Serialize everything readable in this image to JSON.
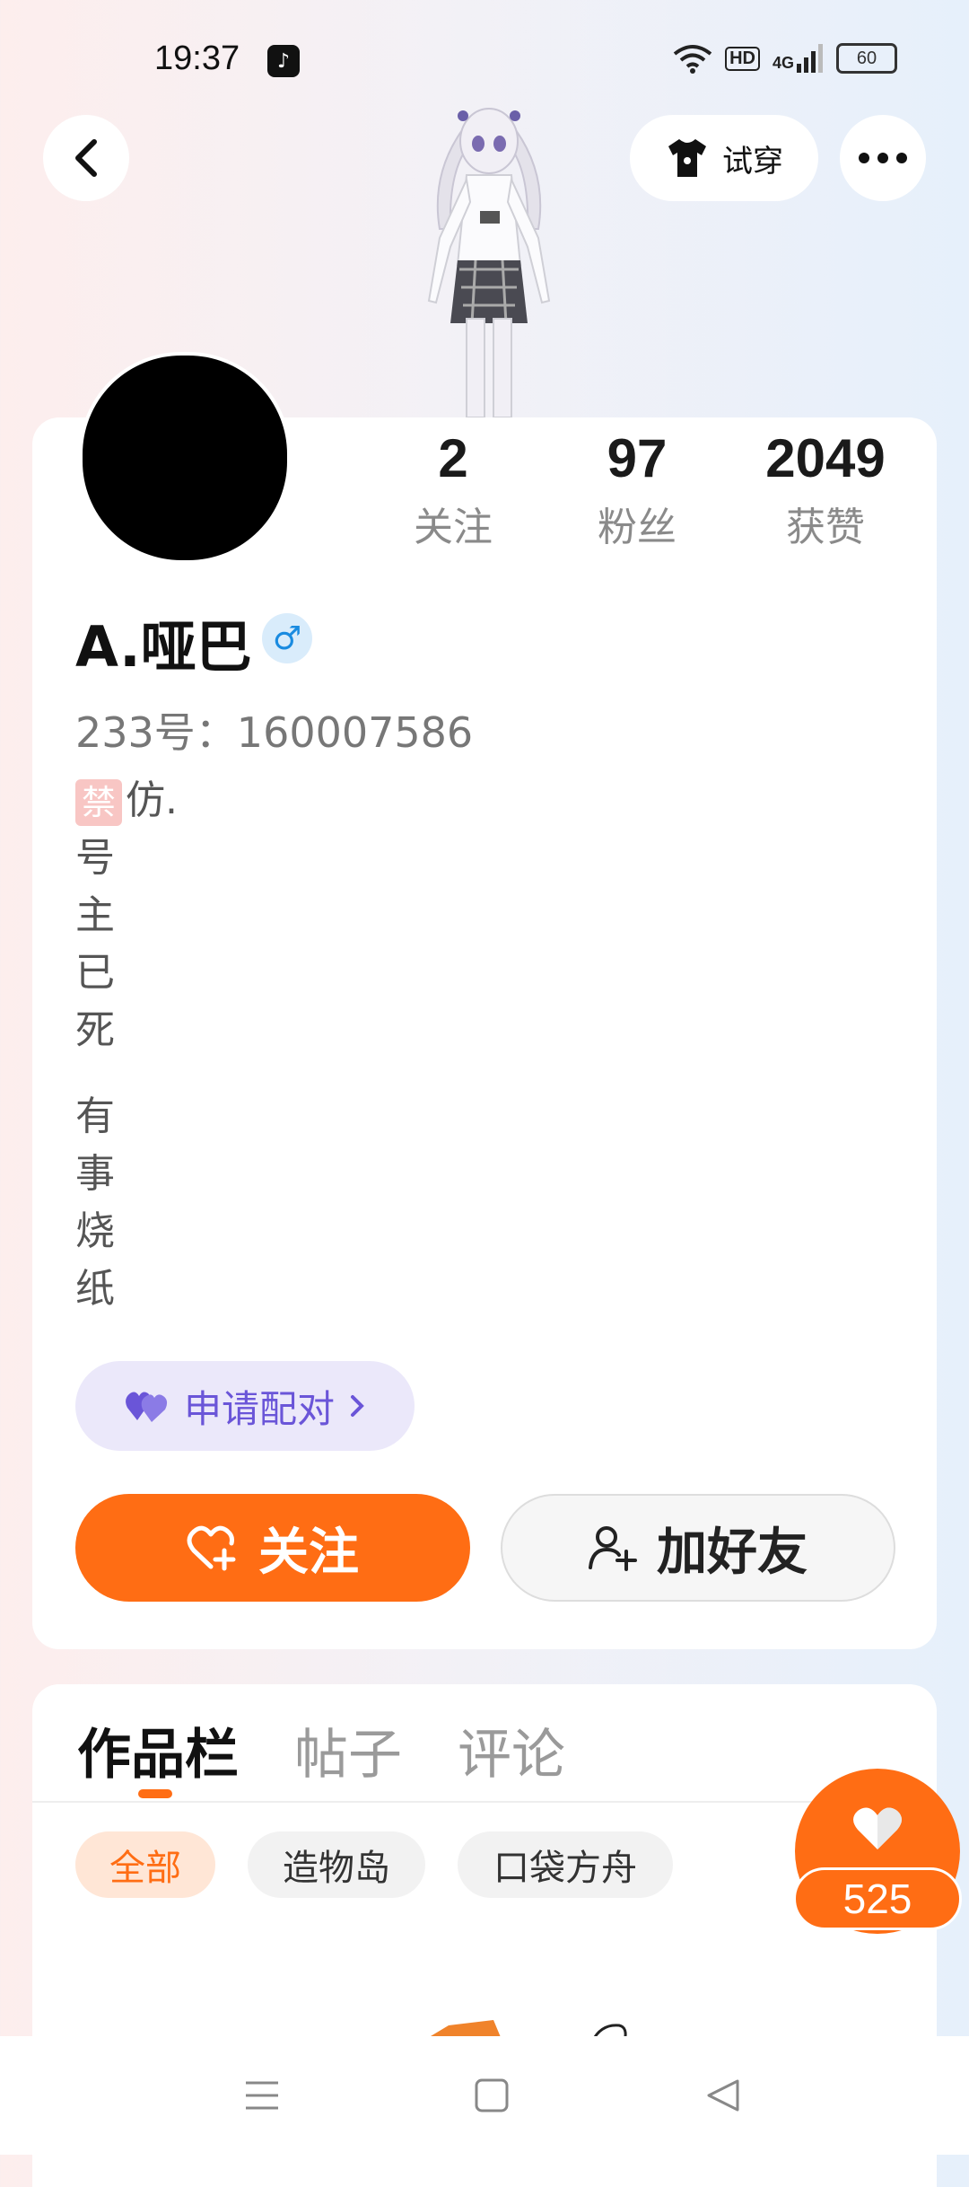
{
  "status_bar": {
    "time": "19:37",
    "hd_label": "HD",
    "network_label": "4G",
    "battery": "60"
  },
  "header": {
    "try_on_label": "试穿"
  },
  "profile": {
    "stats": [
      {
        "value": "2",
        "label": "关注"
      },
      {
        "value": "97",
        "label": "粉丝"
      },
      {
        "value": "2049",
        "label": "获赞"
      }
    ],
    "name": "A.哑巴",
    "gender_symbol": "♂",
    "id_line": "233号：160007586",
    "bio_badge": "禁",
    "bio_lines": [
      "仿.",
      "号",
      "主",
      "已",
      "死",
      "",
      "有",
      "事",
      "烧",
      "纸"
    ],
    "pair_label": "申请配对",
    "follow_label": "关注",
    "add_friend_label": "加好友"
  },
  "works": {
    "tabs": [
      "作品栏",
      "帖子",
      "评论"
    ],
    "chips": [
      "全部",
      "造物岛",
      "口袋方舟"
    ],
    "like_count": "525"
  },
  "colors": {
    "accent": "#ff6d14",
    "pair": "#6a55d8"
  }
}
